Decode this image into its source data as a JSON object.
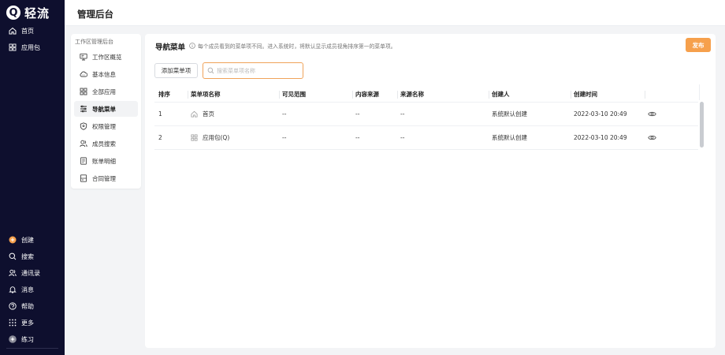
{
  "app": {
    "logo_mark": "Q",
    "logo_text": "轻流"
  },
  "rail": {
    "top_items": [
      {
        "label": "首页",
        "icon": "home-icon"
      },
      {
        "label": "应用包",
        "icon": "apps-icon"
      }
    ],
    "bottom_items": [
      {
        "label": "创建",
        "icon": "plus-circle-icon"
      },
      {
        "label": "搜索",
        "icon": "search-icon"
      },
      {
        "label": "通讯录",
        "icon": "contacts-icon"
      },
      {
        "label": "消息",
        "icon": "bell-icon"
      },
      {
        "label": "帮助",
        "icon": "help-icon"
      },
      {
        "label": "更多",
        "icon": "grid-icon"
      },
      {
        "label": "练习",
        "icon": "avatar-icon"
      }
    ]
  },
  "header": {
    "title": "管理后台"
  },
  "submenu": {
    "title": "工作区管理后台",
    "items": [
      {
        "label": "工作区概览",
        "icon": "monitor-icon"
      },
      {
        "label": "基本信息",
        "icon": "cloud-icon"
      },
      {
        "label": "全部应用",
        "icon": "apps-icon"
      },
      {
        "label": "导航菜单",
        "icon": "sliders-icon",
        "active": true
      },
      {
        "label": "权限管理",
        "icon": "shield-icon"
      },
      {
        "label": "成员搜索",
        "icon": "users-icon"
      },
      {
        "label": "账单明细",
        "icon": "document-icon"
      },
      {
        "label": "合同管理",
        "icon": "contract-icon"
      }
    ]
  },
  "main": {
    "title": "导航菜单",
    "tip": "每个成员看到的菜单项不同。进入系统时，将默认显示成员视角排序第一的菜单项。",
    "publish_label": "发布",
    "add_label": "添加菜单项",
    "search_placeholder": "搜索菜单项名称"
  },
  "table": {
    "columns": [
      "排序",
      "菜单项名称",
      "可见范围",
      "内容来源",
      "来源名称",
      "创建人",
      "创建时间"
    ],
    "rows": [
      {
        "order": "1",
        "name": "首页",
        "icon": "home-icon",
        "scope": "--",
        "source": "--",
        "source_name": "--",
        "creator": "系统默认创建",
        "time": "2022-03-10 20:49"
      },
      {
        "order": "2",
        "name": "应用包(Q)",
        "icon": "apps-icon",
        "scope": "--",
        "source": "--",
        "source_name": "--",
        "creator": "系统默认创建",
        "time": "2022-03-10 20:49"
      }
    ]
  },
  "colors": {
    "rail_bg": "#0e0f2e",
    "accent": "#f6a04c",
    "create_icon": "#f6a04c"
  }
}
